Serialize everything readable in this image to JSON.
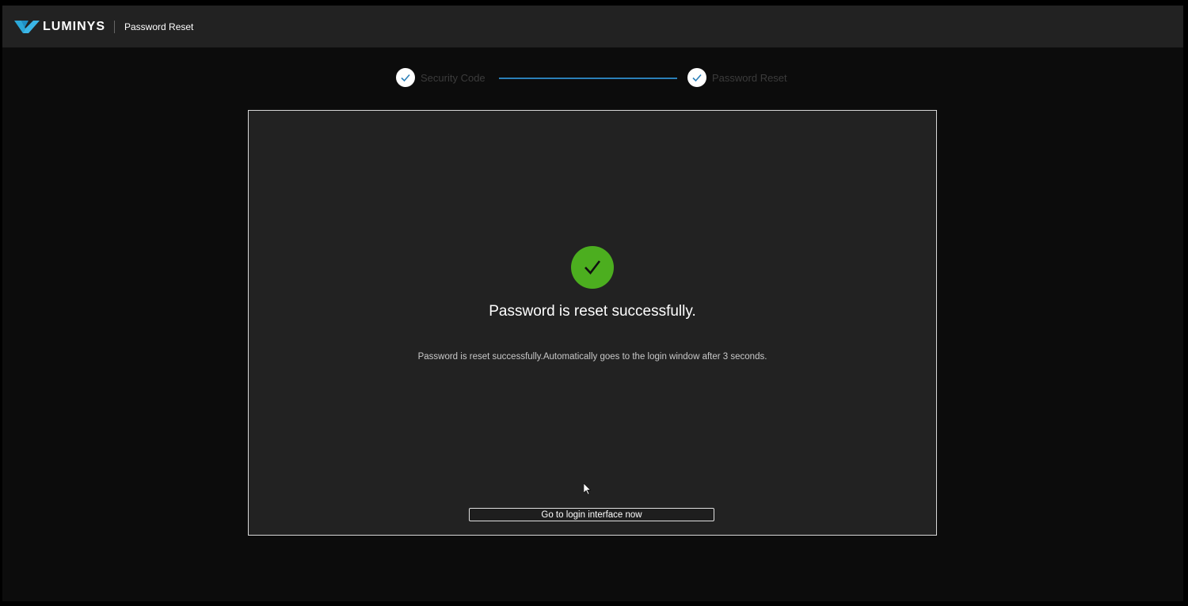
{
  "header": {
    "logo_text": "LUMINYS",
    "logo_icon": "luminys-logo-icon",
    "title": "Password Reset"
  },
  "stepper": {
    "steps": [
      {
        "label": "Security Code",
        "status": "completed",
        "icon": "check-icon"
      },
      {
        "label": "Password Reset",
        "status": "completed",
        "icon": "check-icon"
      }
    ]
  },
  "result": {
    "icon": "check-circle-icon",
    "title": "Password is reset successfully.",
    "message": "Password is reset successfully.Automatically goes to the login window after 3 seconds.",
    "button_label": "Go to login interface now"
  },
  "colors": {
    "success": "#4cae1f",
    "step_line": "#2b7fb8",
    "header_bg": "#222222",
    "card_bg": "#222222",
    "page_bg": "#0c0c0c"
  }
}
